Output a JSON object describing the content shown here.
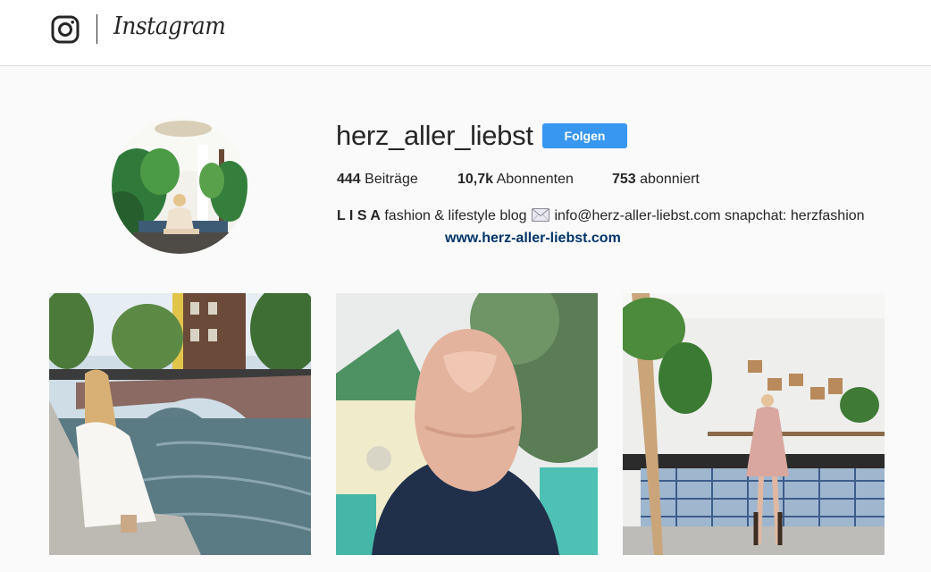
{
  "header": {
    "logo_icon": "instagram-camera-icon",
    "wordmark": "Instagram"
  },
  "profile": {
    "username": "herz_aller_liebst",
    "follow_label": "Folgen",
    "stats": {
      "posts_count": "444",
      "posts_label": "Beiträge",
      "followers_count": "10,7k",
      "followers_label": "Abonnenten",
      "following_count": "753",
      "following_label": "abonniert"
    },
    "bio": {
      "name": "L I S A",
      "text_before_icon": "fashion & lifestyle blog",
      "icon": "envelope-icon",
      "text_after_icon": "info@herz-aller-liebst.com snapchat: herzfashion",
      "website": "www.herz-aller-liebst.com"
    }
  },
  "colors": {
    "accent": "#3897f0",
    "link": "#003569",
    "background": "#fafafa",
    "text": "#262626"
  },
  "posts": [
    {
      "depicts": "woman in white dress sitting by canal bridge"
    },
    {
      "depicts": "woman with braided pink-blonde hair from behind"
    },
    {
      "depicts": "woman in pink dress in room with tiled counter and palm"
    }
  ]
}
